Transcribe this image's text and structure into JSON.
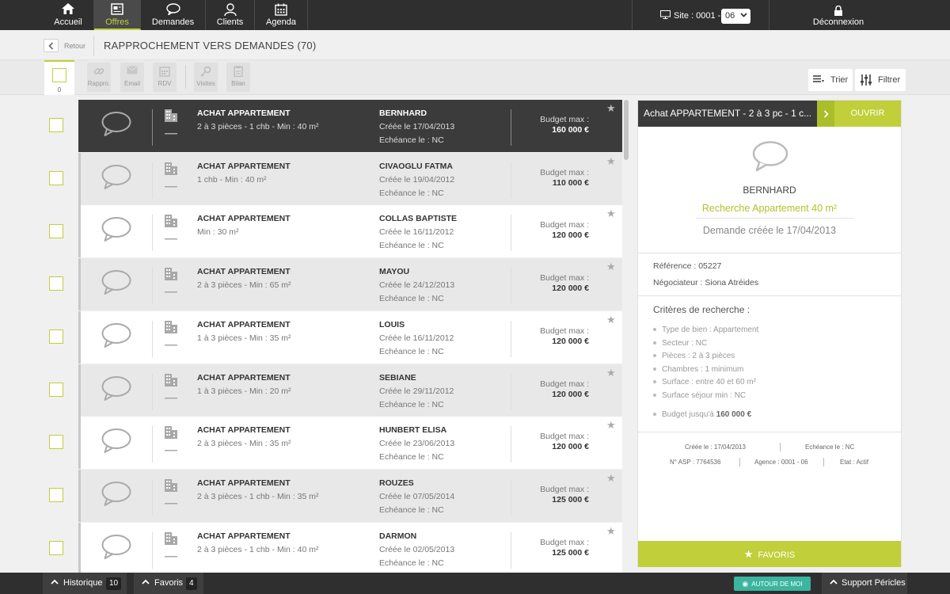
{
  "nav": {
    "items": [
      {
        "label": "Accueil",
        "icon": "home-icon"
      },
      {
        "label": "Offres",
        "icon": "offers-icon"
      },
      {
        "label": "Demandes",
        "icon": "chat-icon"
      },
      {
        "label": "Clients",
        "icon": "user-icon"
      },
      {
        "label": "Agenda",
        "icon": "calendar-icon"
      }
    ],
    "site_label": "Site : 0001 -",
    "site_value": "06",
    "logout_label": "Déconnexion"
  },
  "header": {
    "back_label": "Retour",
    "title": "RAPPROCHEMENT VERS DEMANDES (70)"
  },
  "toolbar": {
    "selected_count": "0",
    "buttons": [
      {
        "label": "Rappro.",
        "icon": "link-icon"
      },
      {
        "label": "Email",
        "icon": "email-icon"
      },
      {
        "label": "RDV",
        "icon": "calendar-icon"
      },
      {
        "label": "Visites",
        "icon": "key-icon"
      },
      {
        "label": "Bilan",
        "icon": "clipboard-icon"
      }
    ],
    "sort_label": "Trier",
    "filter_label": "Filtrer"
  },
  "rows": [
    {
      "type": "ACHAT APPARTEMENT",
      "desc": "2 à 3 pièces - 1 chb - Min : 40 m²",
      "name": "BERNHARD",
      "created": "Créée le 17/04/2013",
      "due": "Echéance le : NC",
      "budget_label": "Budget max :",
      "budget": "160 000 €"
    },
    {
      "type": "ACHAT APPARTEMENT",
      "desc": "1 chb - Min : 40 m²",
      "name": "CIVAOGLU FATMA",
      "created": "Créée le 19/04/2012",
      "due": "Echéance le : NC",
      "budget_label": "Budget max :",
      "budget": "110 000 €"
    },
    {
      "type": "ACHAT APPARTEMENT",
      "desc": "Min : 30 m²",
      "name": "COLLAS BAPTISTE",
      "created": "Créée le 16/11/2012",
      "due": "Echéance le : NC",
      "budget_label": "Budget max :",
      "budget": "120 000 €"
    },
    {
      "type": "ACHAT APPARTEMENT",
      "desc": "2 à 3 pièces - Min : 65 m²",
      "name": "MAYOU",
      "created": "Créée le 24/12/2013",
      "due": "Echéance le : NC",
      "budget_label": "Budget max :",
      "budget": "120 000 €"
    },
    {
      "type": "ACHAT APPARTEMENT",
      "desc": "1 à 3 pièces - Min : 35 m²",
      "name": "LOUIS",
      "created": "Créée le 16/11/2012",
      "due": "Echéance le : NC",
      "budget_label": "Budget max :",
      "budget": "120 000 €"
    },
    {
      "type": "ACHAT APPARTEMENT",
      "desc": "1 à 3 pièces - Min : 20 m²",
      "name": "SEBIANE",
      "created": "Créée le 29/11/2012",
      "due": "Echéance le : NC",
      "budget_label": "Budget max :",
      "budget": "120 000 €"
    },
    {
      "type": "ACHAT APPARTEMENT",
      "desc": "2 à 3 pièces - Min : 35 m²",
      "name": "HUNBERT ELISA",
      "created": "Créée le 23/06/2013",
      "due": "Echéance le : NC",
      "budget_label": "Budget max :",
      "budget": "120 000 €"
    },
    {
      "type": "ACHAT APPARTEMENT",
      "desc": "2 à 3 pièces - 1 chb - Min : 35 m²",
      "name": "ROUZES",
      "created": "Créée le 07/05/2014",
      "due": "Echéance le : NC",
      "budget_label": "Budget max :",
      "budget": "125 000 €"
    },
    {
      "type": "ACHAT APPARTEMENT",
      "desc": "2 à 3 pièces - 1 chb - Min : 40 m²",
      "name": "DARMON",
      "created": "Créée le 02/05/2013",
      "due": "Echéance le : NC",
      "budget_label": "Budget max :",
      "budget": "125 000 €"
    }
  ],
  "detail": {
    "title": "Achat APPARTEMENT - 2 à 3 pc - 1 c...",
    "open_label": "OUVRIR",
    "name": "BERNHARD",
    "search": "Recherche Appartement 40 m²",
    "created": "Demande créée le 17/04/2013",
    "reference": "Référence : 05227",
    "negotiator": "Négociateur : Siona Atréides",
    "criteria_title": "Critères de recherche :",
    "criteria": [
      "Type de bien : Appartement",
      "Secteur : NC",
      "Pièces : 2 à 3 pièces",
      "Chambres : 1 minimum",
      "Surface : entre 40 et 60 m²",
      "Surface séjour min : NC"
    ],
    "budget_prefix": "Budget jusqu'à",
    "budget_value": "160 000 €",
    "footer": {
      "created": "Créée le : 17/04/2013",
      "due": "Echéance le : NC",
      "asp": "N° ASP : 7764536",
      "agency": "Agence : 0001 - 06",
      "status": "Etat : Actif"
    },
    "favoris_label": "FAVORIS"
  },
  "bottom": {
    "history_label": "Historique",
    "history_count": "10",
    "favorites_label": "Favoris",
    "favorites_count": "4",
    "around_label": "AUTOUR DE MOI",
    "support_label": "Support Péricles"
  },
  "colors": {
    "accent": "#c0cf3a",
    "dark": "#2f2f2f",
    "teal": "#3bb5a0"
  }
}
